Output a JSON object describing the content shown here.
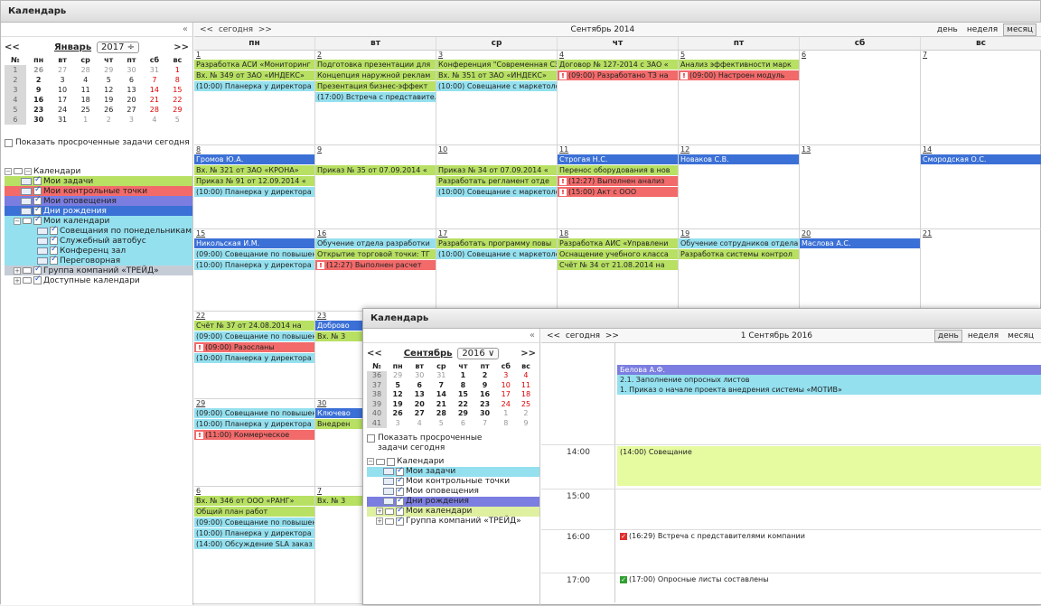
{
  "window_title": "Календарь",
  "collapse": "«",
  "mini": {
    "prev": "<<",
    "next": ">>",
    "month": "Январь",
    "year": "2017 ÷",
    "headers": [
      "№",
      "пн",
      "вт",
      "ср",
      "чт",
      "пт",
      "сб",
      "вс"
    ],
    "rows": [
      [
        "1",
        "26",
        "27",
        "28",
        "29",
        "30",
        "31",
        "1"
      ],
      [
        "2",
        "2",
        "3",
        "4",
        "5",
        "6",
        "7",
        "8"
      ],
      [
        "3",
        "9",
        "10",
        "11",
        "12",
        "13",
        "14",
        "15"
      ],
      [
        "4",
        "16",
        "17",
        "18",
        "19",
        "20",
        "21",
        "22"
      ],
      [
        "5",
        "23",
        "24",
        "25",
        "26",
        "27",
        "28",
        "29"
      ],
      [
        "6",
        "30",
        "31",
        "1",
        "2",
        "3",
        "4",
        "5"
      ]
    ]
  },
  "overdue_label": "Показать просроченные задачи сегодня",
  "tree": {
    "root": "Календари",
    "items": [
      "Мои задачи",
      "Мои контрольные точки",
      "Мои оповещения",
      "Дни рождения"
    ],
    "my_cal": "Мои календари",
    "subs": [
      "Совещания по понедельникам",
      "Служебный автобус",
      "Конференц зал",
      "Переговорная"
    ],
    "group": "Группа компаний «ТРЕЙД»",
    "avail": "Доступные календари"
  },
  "toolbar": {
    "prev": "<<",
    "today": "сегодня",
    "next": ">>",
    "period": "Сентябрь 2014",
    "views": [
      "день",
      "неделя",
      "месяц"
    ]
  },
  "dows": [
    "пн",
    "вт",
    "ср",
    "чт",
    "пт",
    "сб",
    "вс"
  ],
  "weeks": [
    {
      "h": 105,
      "days": [
        {
          "n": "1",
          "ev": [
            [
              "g",
              "Разработка АСИ «Мониторинг"
            ],
            [
              "g",
              "Вх. № 349 от ЗАО «ИНДЕКС»"
            ],
            [
              "c",
              "(10:00) Планерка у директора"
            ]
          ]
        },
        {
          "n": "2",
          "ev": [
            [
              "g",
              "Подготовка презентации для"
            ],
            [
              "g",
              "Концепция наружной реклам"
            ],
            [
              "g",
              "Презентация бизнес-эффект"
            ],
            [
              "c",
              "(17:00) Встреча с представител"
            ]
          ]
        },
        {
          "n": "3",
          "ev": [
            [
              "g",
              "Конференция \"Современная СЭ"
            ],
            [
              "g",
              "Вх. № 351 от ЗАО «ИНДЕКС»"
            ],
            [
              "c",
              "(10:00) Совещание с маркетолог"
            ]
          ]
        },
        {
          "n": "4",
          "ev": [
            [
              "g",
              "Договор № 127-2014 с ЗАО «"
            ],
            [
              "r",
              "(09:00) Разработано ТЗ на",
              1
            ]
          ]
        },
        {
          "n": "5",
          "ev": [
            [
              "g",
              "Анализ эффективности марк"
            ],
            [
              "r",
              "(09:00) Настроен модуль",
              1
            ]
          ]
        },
        {
          "n": "6",
          "ev": []
        },
        {
          "n": "7",
          "ev": []
        }
      ]
    },
    {
      "h": 93,
      "days": [
        {
          "n": "8",
          "ev": [
            [
              "b",
              "Громов Ю.А."
            ],
            [
              "g",
              "Вх. № 321 от ЗАО «КРОНА»"
            ],
            [
              "g",
              "Приказ № 91 от 12.09.2014 «"
            ],
            [
              "c",
              "(10:00) Планерка у директора"
            ]
          ]
        },
        {
          "n": "9",
          "ev": [
            [
              "w",
              ""
            ],
            [
              "g",
              "Приказ № 35 от 07.09.2014 «"
            ]
          ]
        },
        {
          "n": "10",
          "ev": [
            [
              "w",
              ""
            ],
            [
              "g",
              "Приказ № 34 от 07.09.2014 «"
            ],
            [
              "g",
              "Разработать регламент отде"
            ],
            [
              "c",
              "(10:00) Совещание с маркетолог"
            ]
          ]
        },
        {
          "n": "11",
          "ev": [
            [
              "b",
              "Строгая Н.С."
            ],
            [
              "g",
              "Перенос оборудования в нов"
            ],
            [
              "r",
              "(12:27) Выполнен анализ",
              1
            ],
            [
              "r",
              "(15:00) Акт с ООО",
              1
            ]
          ]
        },
        {
          "n": "12",
          "ev": [
            [
              "b",
              "Новаков С.В."
            ]
          ]
        },
        {
          "n": "13",
          "ev": []
        },
        {
          "n": "14",
          "ev": [
            [
              "b",
              "Смородская О.С."
            ]
          ]
        }
      ]
    },
    {
      "h": 91,
      "days": [
        {
          "n": "15",
          "ev": [
            [
              "b",
              "Никольская И.М."
            ],
            [
              "c",
              "(09:00) Совещание по повышен"
            ],
            [
              "c",
              "(10:00) Планерка у директора"
            ]
          ]
        },
        {
          "n": "16",
          "ev": [
            [
              "c",
              "Обучение отдела разработки"
            ],
            [
              "g",
              "Открытие торговой точки: ТГ"
            ],
            [
              "r",
              "(12:27) Выполнен расчет",
              1
            ]
          ]
        },
        {
          "n": "17",
          "ev": [
            [
              "g",
              "Разработать программу повы"
            ],
            [
              "c",
              "(10:00) Совещание с маркетолог"
            ]
          ]
        },
        {
          "n": "18",
          "ev": [
            [
              "g",
              "Разработка АИС «Управлени"
            ],
            [
              "g",
              "Оснащение учебного класса"
            ],
            [
              "g",
              "Счёт № 34 от 21.08.2014 на"
            ]
          ]
        },
        {
          "n": "19",
          "ev": [
            [
              "c",
              "Обучение сотрудников отдела"
            ],
            [
              "g",
              "Разработка системы контрол"
            ]
          ]
        },
        {
          "n": "20",
          "ev": [
            [
              "b",
              "Маслова А.С."
            ]
          ]
        },
        {
          "n": "21",
          "ev": []
        }
      ]
    },
    {
      "h": 97,
      "days": [
        {
          "n": "22",
          "ev": [
            [
              "g",
              "Счёт № 37 от 24.08.2014 на"
            ],
            [
              "c",
              "(09:00) Совещание по повышен"
            ],
            [
              "r",
              "(09:00) Разосланы",
              1
            ],
            [
              "c",
              "(10:00) Планерка у директора"
            ]
          ]
        },
        {
          "n": "23",
          "ev": [
            [
              "b",
              "Доброво"
            ],
            [
              "g",
              "Вх. № 3"
            ]
          ]
        },
        {
          "n": "",
          "ev": []
        },
        {
          "n": "",
          "ev": []
        },
        {
          "n": "",
          "ev": []
        },
        {
          "n": "",
          "ev": []
        },
        {
          "n": "",
          "ev": []
        }
      ]
    },
    {
      "h": 97,
      "days": [
        {
          "n": "29",
          "ev": [
            [
              "c",
              "(09:00) Совещание по повышен"
            ],
            [
              "c",
              "(10:00) Планерка у директора"
            ],
            [
              "r",
              "(11:00) Коммерческое",
              1
            ]
          ]
        },
        {
          "n": "30",
          "ev": [
            [
              "b",
              "Ключево"
            ],
            [
              "g",
              "Внедрен"
            ]
          ]
        },
        {
          "n": "",
          "ev": []
        },
        {
          "n": "",
          "ev": []
        },
        {
          "n": "",
          "ev": []
        },
        {
          "n": "",
          "ev": []
        },
        {
          "n": "",
          "ev": []
        }
      ]
    },
    {
      "h": 130,
      "days": [
        {
          "n": "6",
          "ev": [
            [
              "g",
              "Вх. № 346 от ООО «РАНГ»"
            ],
            [
              "g",
              "Общий план работ"
            ],
            [
              "c",
              "(09:00) Совещание по повышен"
            ],
            [
              "c",
              "(10:00) Планерка у директора"
            ],
            [
              "c",
              "(14:00) Обсуждение SLA заказ"
            ]
          ]
        },
        {
          "n": "7",
          "ev": [
            [
              "g",
              "Вх. № 3"
            ]
          ]
        },
        {
          "n": "",
          "ev": []
        },
        {
          "n": "",
          "ev": []
        },
        {
          "n": "",
          "ev": []
        },
        {
          "n": "",
          "ev": []
        },
        {
          "n": "",
          "ev": []
        }
      ]
    }
  ],
  "overlay": {
    "title": "Календарь",
    "collapse": "«",
    "mini": {
      "prev": "<<",
      "next": ">>",
      "month": "Сентябрь",
      "year": "2016 ∨",
      "headers": [
        "№",
        "пн",
        "вт",
        "ср",
        "чт",
        "пт",
        "сб",
        "вс"
      ],
      "rows": [
        [
          "36",
          "29",
          "30",
          "31",
          "1",
          "2",
          "3",
          "4"
        ],
        [
          "37",
          "5",
          "6",
          "7",
          "8",
          "9",
          "10",
          "11"
        ],
        [
          "38",
          "12",
          "13",
          "14",
          "15",
          "16",
          "17",
          "18"
        ],
        [
          "39",
          "19",
          "20",
          "21",
          "22",
          "23",
          "24",
          "25"
        ],
        [
          "40",
          "26",
          "27",
          "28",
          "29",
          "30",
          "1",
          "2"
        ],
        [
          "41",
          "3",
          "4",
          "5",
          "6",
          "7",
          "8",
          "9"
        ]
      ]
    },
    "overdue_label": "Показать просроченные задачи сегодня",
    "tree": {
      "root": "Календари",
      "items": [
        "Мои задачи",
        "Мои контрольные точки",
        "Мои оповещения",
        "Дни рождения"
      ],
      "my_cal": "Мои календари",
      "group": "Группа компаний «ТРЕЙД»"
    },
    "toolbar": {
      "prev": "<<",
      "today": "сегодня",
      "next": ">>",
      "period": "1 Сентябрь 2016",
      "views": [
        "день",
        "неделя",
        "месяц"
      ]
    },
    "allday": {
      "person": "Белова А.Ф.",
      "e1": "2.1. Заполнение опросных листов",
      "e2": "1. Приказ о начале проекта внедрения системы «МОТИВ»"
    },
    "hours": [
      {
        "t": "",
        "ev": ""
      },
      {
        "t": "14:00",
        "ev": "(14:00) Совещание"
      },
      {
        "t": "15:00",
        "ev": ""
      },
      {
        "t": "16:00",
        "ev": "(16:29) Встреча с представителями компании"
      },
      {
        "t": "17:00",
        "ev": "(17:00) Опросные листы составлены"
      }
    ]
  }
}
